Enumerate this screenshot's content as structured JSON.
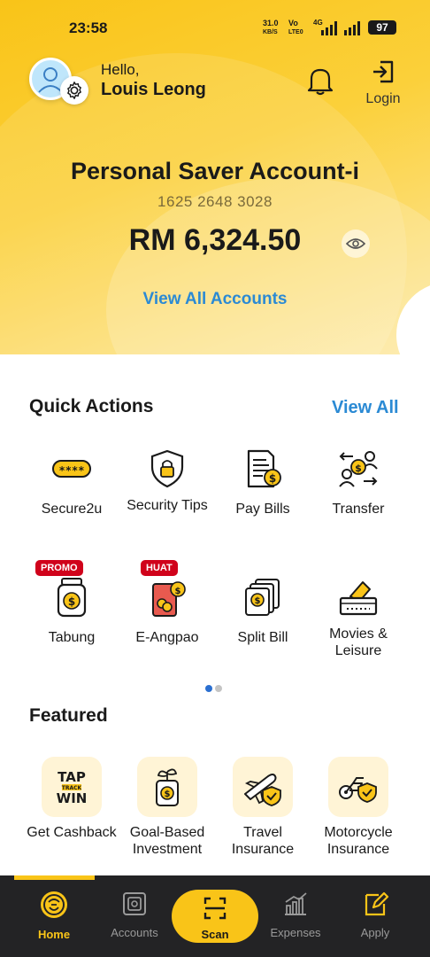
{
  "status_bar": {
    "time": "23:58",
    "net_speed": "31.0",
    "net_unit": "KB/S",
    "volte_1": "Vo",
    "volte_2": "LTE0",
    "network": "4G",
    "battery": "97"
  },
  "header": {
    "greeting": "Hello,",
    "user_name": "Louis Leong",
    "login_label": "Login"
  },
  "account": {
    "name": "Personal Saver Account-i",
    "number": "1625 2648 3028",
    "balance": "RM 6,324.50",
    "view_all_label": "View All Accounts"
  },
  "quick_actions": {
    "title": "Quick Actions",
    "view_all_label": "View All",
    "items": [
      {
        "label": "Secure2u",
        "icon": "secure2u-icon"
      },
      {
        "label": "Security Tips",
        "icon": "shield-lock-icon"
      },
      {
        "label": "Pay Bills",
        "icon": "bill-icon"
      },
      {
        "label": "Transfer",
        "icon": "transfer-icon"
      },
      {
        "label": "Tabung",
        "icon": "jar-icon",
        "tag": "PROMO"
      },
      {
        "label": "E-Angpao",
        "icon": "angpao-icon",
        "tag": "HUAT"
      },
      {
        "label": "Split Bill",
        "icon": "split-bill-icon"
      },
      {
        "label": "Movies & Leisure",
        "icon": "ticket-icon"
      }
    ],
    "page_count": 2,
    "active_page": 1
  },
  "featured": {
    "title": "Featured",
    "items": [
      {
        "label": "Get Cashback",
        "icon": "tap-track-win-icon",
        "logo_line1": "TAP",
        "logo_line2": "TRACK",
        "logo_line3": "WIN"
      },
      {
        "label": "Goal-Based Investment",
        "icon": "money-plant-icon"
      },
      {
        "label": "Travel Insurance",
        "icon": "plane-shield-icon"
      },
      {
        "label": "Motorcycle Insurance",
        "icon": "motorcycle-shield-icon"
      }
    ]
  },
  "tab_bar": {
    "tabs": [
      {
        "label": "Home",
        "icon": "home-tiger-icon",
        "active": true
      },
      {
        "label": "Accounts",
        "icon": "safe-icon",
        "active": false
      },
      {
        "label": "Scan",
        "icon": "scan-icon",
        "active": false
      },
      {
        "label": "Expenses",
        "icon": "chart-icon",
        "active": false
      },
      {
        "label": "Apply",
        "icon": "edit-icon",
        "active": false
      }
    ]
  },
  "colors": {
    "brand_yellow": "#f9c418",
    "link_blue": "#2b8ad4",
    "tag_red": "#d0021b",
    "tab_bg": "#232325"
  }
}
